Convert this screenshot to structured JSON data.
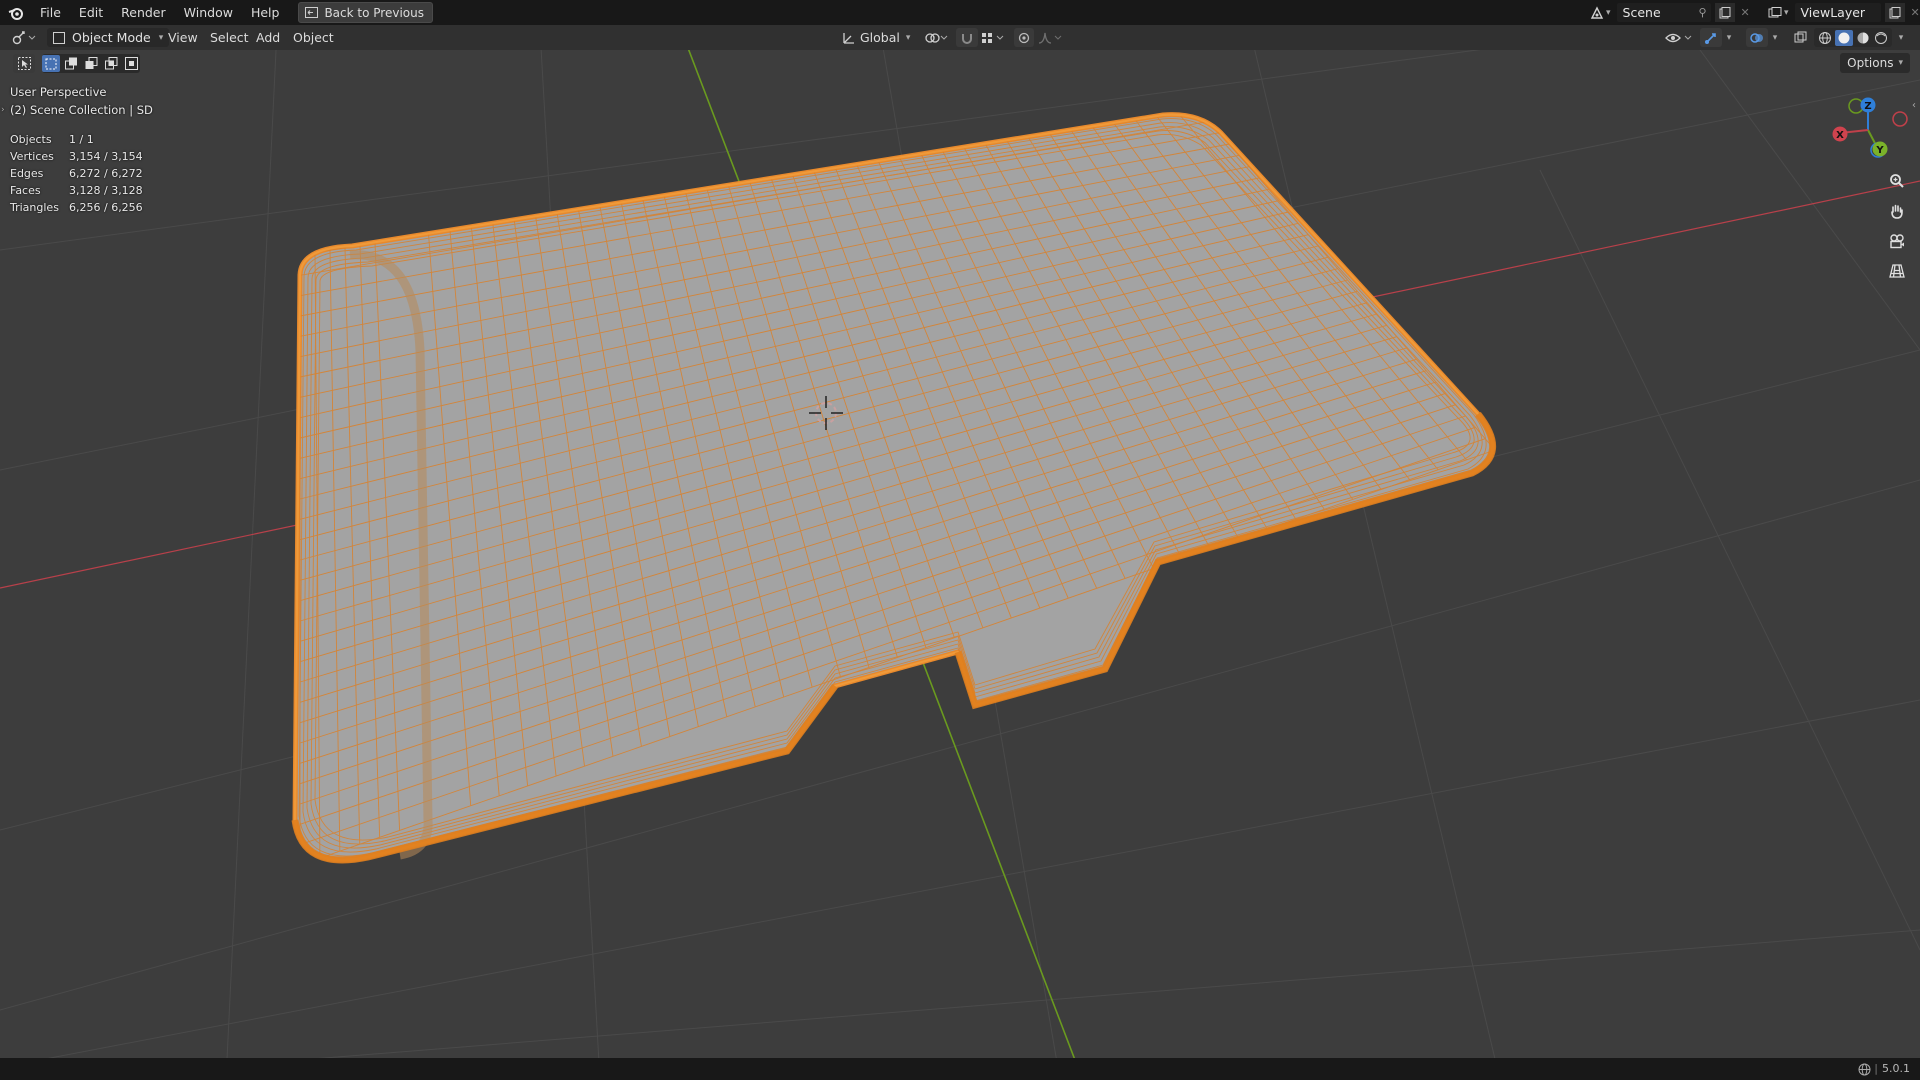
{
  "menu": {
    "file": "File",
    "edit": "Edit",
    "render": "Render",
    "window": "Window",
    "help": "Help",
    "back_to_previous": "Back to Previous"
  },
  "scene": {
    "name": "Scene"
  },
  "view_layer": {
    "name": "ViewLayer"
  },
  "header": {
    "mode": "Object Mode",
    "view": "View",
    "select": "Select",
    "add": "Add",
    "object": "Object",
    "orientation": "Global",
    "options": "Options"
  },
  "viewport": {
    "perspective": "User Perspective",
    "collection": "(2) Scene Collection | SD"
  },
  "stats": [
    {
      "label": "Objects",
      "value": "1 / 1"
    },
    {
      "label": "Vertices",
      "value": "3,154 / 3,154"
    },
    {
      "label": "Edges",
      "value": "6,272 / 6,272"
    },
    {
      "label": "Faces",
      "value": "3,128 / 3,128"
    },
    {
      "label": "Triangles",
      "value": "6,256 / 6,256"
    }
  ],
  "gizmo": {
    "x": "X",
    "y": "Y",
    "z": "Z"
  },
  "status": {
    "version": "5.0.1"
  },
  "colors": {
    "background": "#3d3d3d",
    "selection_outline": "#e8892c",
    "mesh_face": "#a6a6a6",
    "x_axis": "#c0404a",
    "y_axis": "#6a9a1f",
    "z_axis": "#2f7fd8"
  }
}
